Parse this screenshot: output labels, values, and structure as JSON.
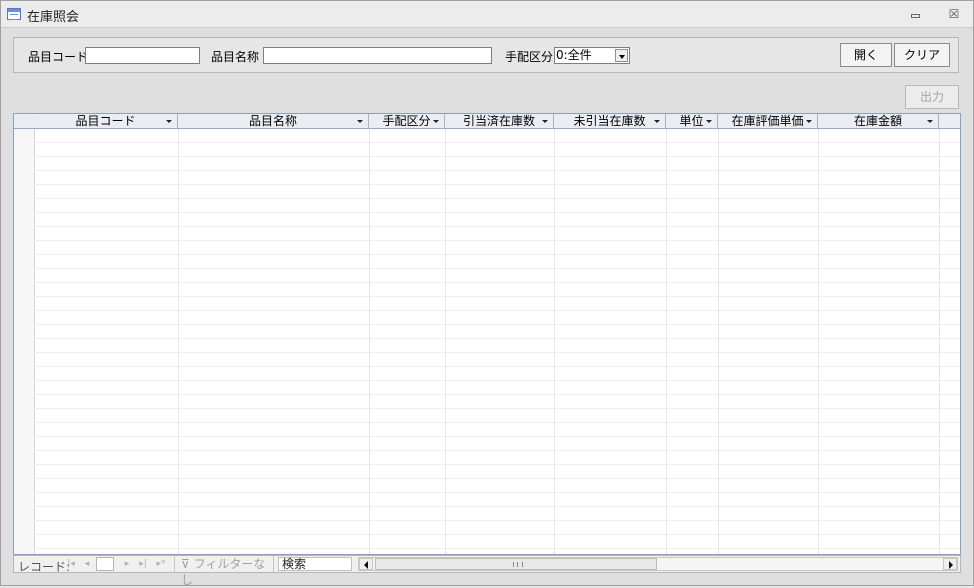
{
  "window": {
    "title": "在庫照会",
    "title_icon": "form-icon",
    "minimize_icon": "minimize-icon",
    "close_glyph": "☒"
  },
  "filters": {
    "item_code_label": "品目コード",
    "item_code_value": "",
    "item_name_label": "品目名称",
    "item_name_value": "",
    "arrangement_label": "手配区分",
    "arrangement_value": "0:全件"
  },
  "buttons": {
    "open": "開く",
    "clear": "クリア",
    "output": "出力"
  },
  "table": {
    "columns": [
      "品目コード",
      "品目名称",
      "手配区分",
      "引当済在庫数",
      "未引当在庫数",
      "単位",
      "在庫評価単価",
      "在庫金額"
    ],
    "rows": []
  },
  "navigation": {
    "record_label": "レコード:",
    "record_value": "",
    "filter_label": "フィルターなし",
    "search_label": "検索"
  },
  "colors": {
    "grid_header": "#ebedf3",
    "window_bg": "#dfdfdf"
  }
}
